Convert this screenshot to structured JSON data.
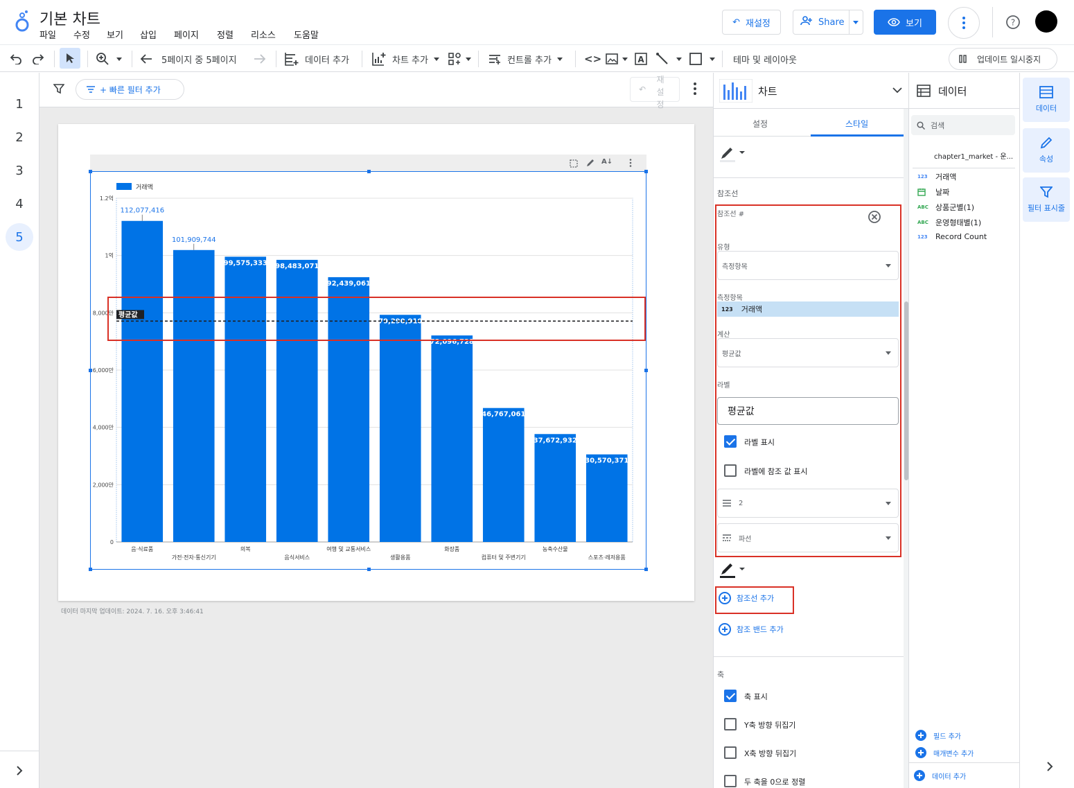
{
  "app": {
    "title": "기본 차트",
    "menus": [
      "파일",
      "수정",
      "보기",
      "삽입",
      "페이지",
      "정렬",
      "리소스",
      "도움말"
    ],
    "reset_label": "재설정",
    "share_label": "Share",
    "view_label": "보기"
  },
  "toolbar": {
    "page_indicator": "5페이지 중 5페이지",
    "add_data": "데이터 추가",
    "add_chart": "차트 추가",
    "add_control": "컨트롤 추가",
    "theme_layout": "테마 및 레이아웃",
    "pause_updates": "업데이트 일시중지"
  },
  "pages": {
    "items": [
      "1",
      "2",
      "3",
      "4",
      "5"
    ],
    "active": "5"
  },
  "filterbar": {
    "quick_filter": "+ 빠른 필터 추가",
    "reset_vertical": "재설정"
  },
  "canvas": {
    "last_updated": "데이터 마지막 업데이트: 2024. 7. 16. 오후 3:46:41"
  },
  "chart_data": {
    "type": "bar",
    "legend": [
      "거래액"
    ],
    "legend_position": "top-left",
    "series": [
      {
        "name": "거래액",
        "color": "#0073e6",
        "values": [
          112077416,
          101909744,
          99575333,
          98483071,
          92439061,
          79290910,
          72096728,
          46767061,
          37672932,
          30570371
        ],
        "value_labels": [
          "112,077,416",
          "101,909,744",
          "99,575,333",
          "98,483,071",
          "92,439,061",
          "79,290,910",
          "72,096,728",
          "46,767,061",
          "37,672,932",
          "30,570,371"
        ]
      }
    ],
    "categories": [
      "음·식료품",
      "가전·전자·통신기기",
      "의복",
      "음식서비스",
      "여행 및 교통서비스",
      "생활용품",
      "화장품",
      "컴퓨터 및 주변기기",
      "농축수산물",
      "스포츠·레저용품"
    ],
    "yticks": [
      "0",
      "2,000만",
      "4,000만",
      "6,000만",
      "8,000만",
      "1억",
      "1.2억"
    ],
    "ylim": [
      0,
      120000000
    ],
    "grid": true,
    "reference_line": {
      "label": "평균값",
      "value": 77090263,
      "style": "dashed"
    }
  },
  "props": {
    "panel_title": "차트",
    "tabs": [
      "설정",
      "스타일"
    ],
    "active_tab": "스타일",
    "section_refline": "참조선",
    "refline_heading": "참조선 #",
    "type_label": "유형",
    "type_value": "측정항목",
    "metric_label": "측정항목",
    "metric_value": "거래액",
    "metric_type": "123",
    "calc_label": "계산",
    "calc_value": "평균값",
    "label_label": "라벨",
    "label_value": "평균값",
    "show_label": "라벨 표시",
    "show_label_checked": true,
    "show_value_in_label": "라벨에 참조 값 표시",
    "show_value_in_label_checked": false,
    "line_weight": "2",
    "line_style": "파선",
    "add_refline": "참조선 추가",
    "add_refband": "참조 밴드 추가",
    "section_axis": "축",
    "axis_show": "축 표시",
    "axis_show_checked": true,
    "y_reverse": "Y축 방향 뒤집기",
    "x_reverse": "X축 방향 뒤집기",
    "align_zero": "두 축을 0으로 정렬"
  },
  "data_panel": {
    "title": "데이터",
    "search_placeholder": "검색",
    "source": "chapter1_market - 운...",
    "fields": [
      {
        "type": "123",
        "name": "거래액"
      },
      {
        "type": "date",
        "name": "날짜"
      },
      {
        "type": "ABC",
        "name": "상품군별(1)"
      },
      {
        "type": "ABC",
        "name": "운영형태별(1)"
      },
      {
        "type": "123",
        "name": "Record Count"
      }
    ],
    "add_field": "필드 추가",
    "add_param": "매개변수 추가",
    "add_data": "데이터 추가"
  },
  "side_rail": {
    "data": "데이터",
    "props": "속성",
    "filter": "필터 표시줄"
  }
}
